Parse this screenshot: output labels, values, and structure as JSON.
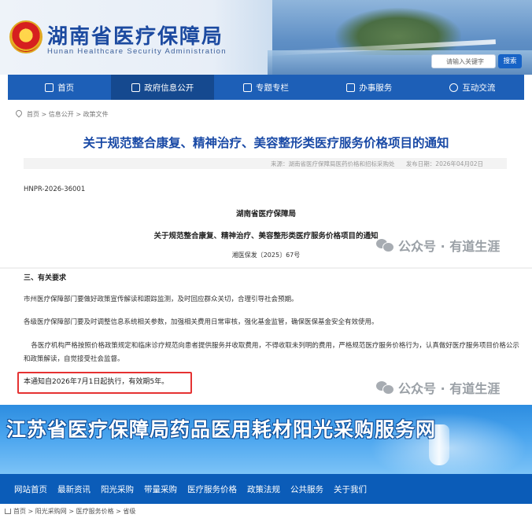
{
  "hunan": {
    "title": "湖南省医疗保障局",
    "subtitle": "Hunan Healthcare Security Administration",
    "search_placeholder": "请输入关键字",
    "search_button": "搜索",
    "nav": [
      {
        "label": "首页",
        "icon": "home-icon"
      },
      {
        "label": "政府信息公开",
        "icon": "document-icon"
      },
      {
        "label": "专题专栏",
        "icon": "topic-icon"
      },
      {
        "label": "办事服务",
        "icon": "service-icon"
      },
      {
        "label": "互动交流",
        "icon": "chat-icon"
      }
    ],
    "breadcrumb": "首页 > 信息公开 > 政策文件"
  },
  "article": {
    "title": "关于规范整合康复、精神治疗、美容整形类医疗服务价格项目的通知",
    "source": "来源：湖南省医疗保障局医药价格和招标采购处",
    "date": "发布日期：2026年04月02日",
    "code": "HNPR-2026-36001",
    "org": "湖南省医疗保障局",
    "doc_title": "关于规范整合康复、精神治疗、美容整形类医疗服务价格项目的通知",
    "doc_no": "湘医保发〔2025〕67号",
    "section_heading": "三、有关要求",
    "paragraphs": [
      "市州医疗保障部门要做好政策宣传解读和跟踪监测，及时回应群众关切，合理引导社会预期。",
      "各级医疗保障部门要及时调整信息系统相关参数，加强相关费用日常审核，强化基金监管，确保医保基金安全有效使用。",
      "各医疗机构严格按照价格政策规定和临床诊疗规范向患者提供服务并收取费用，不得收取未列明的费用，严格规范医疗服务价格行为，认真做好医疗服务项目价格公示和政策解读，自觉接受社会监督。"
    ],
    "notice": "本通知自2026年7月1日起执行，有效期5年。"
  },
  "watermark": "公众号 · 有道生涯",
  "jiangsu": {
    "title": "江苏省医疗保障局药品医用耗材阳光采购服务网",
    "nav": [
      "网站首页",
      "最新资讯",
      "阳光采购",
      "带量采购",
      "医疗服务价格",
      "政策法规",
      "公共服务",
      "关于我们"
    ],
    "breadcrumb": "首页 > 阳光采购网 > 医疗服务价格 > 省级"
  },
  "colors": {
    "hunan_nav": "#1d5fb7",
    "title_blue": "#1a4aa6",
    "highlight_red": "#e53232",
    "jiangsu_nav": "#0b5cb8"
  }
}
